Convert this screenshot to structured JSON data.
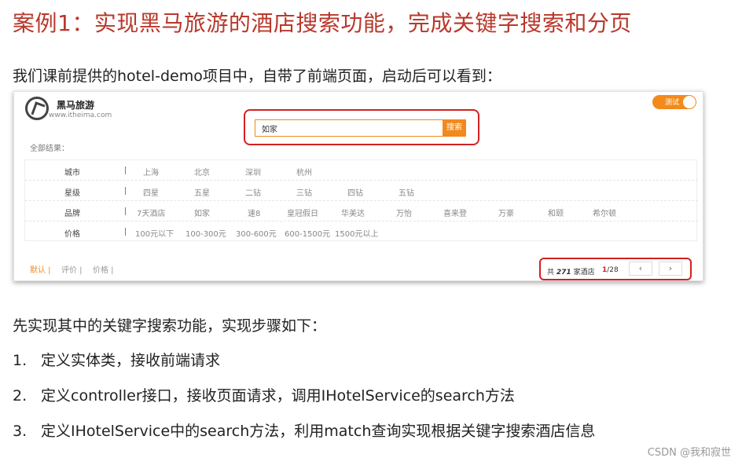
{
  "slide_title": "案例1：实现黑马旅游的酒店搜索功能，完成关键字搜索和分页",
  "intro": "我们课前提供的hotel-demo项目中，自带了前端页面，启动后可以看到：",
  "app": {
    "brand_name": "黑马旅游",
    "brand_url": "www.itheima.com",
    "toggle_label": "测试",
    "search": {
      "value": "如家",
      "button_label": "搜索"
    },
    "all_results_label": "全部结果：",
    "filters": [
      {
        "label": "城市",
        "options": [
          "上海",
          "北京",
          "深圳",
          "杭州"
        ]
      },
      {
        "label": "星级",
        "options": [
          "四星",
          "五星",
          "二钻",
          "三钻",
          "四钻",
          "五钻"
        ]
      },
      {
        "label": "品牌",
        "options": [
          "7天酒店",
          "如家",
          "速8",
          "皇冠假日",
          "华美达",
          "万怡",
          "喜来登",
          "万豪",
          "和颐",
          "希尔顿"
        ]
      },
      {
        "label": "价格",
        "options": [
          "100元以下",
          "100-300元",
          "300-600元",
          "600-1500元",
          "1500元以上"
        ]
      }
    ],
    "sort": {
      "default": "默认 |",
      "rating": "评价 |",
      "price": "价格 |"
    },
    "pager": {
      "total_prefix": "共",
      "total_count": "271",
      "total_suffix": "家酒店",
      "current_page": "1",
      "total_pages": "/28",
      "prev": "‹",
      "next": "›"
    }
  },
  "sub_heading": "先实现其中的关键字搜索功能，实现步骤如下：",
  "steps": [
    {
      "num": "1.",
      "text": "定义实体类，接收前端请求"
    },
    {
      "num": "2.",
      "text": "定义controller接口，接收页面请求，调用IHotelService的search方法"
    },
    {
      "num": "3.",
      "text": "定义IHotelService中的search方法，利用match查询实现根据关键字搜索酒店信息"
    }
  ],
  "watermark": "CSDN @我和寂世",
  "colors": {
    "title": "#b8382b",
    "accent": "#f28a1c",
    "highlight": "#d42020"
  }
}
